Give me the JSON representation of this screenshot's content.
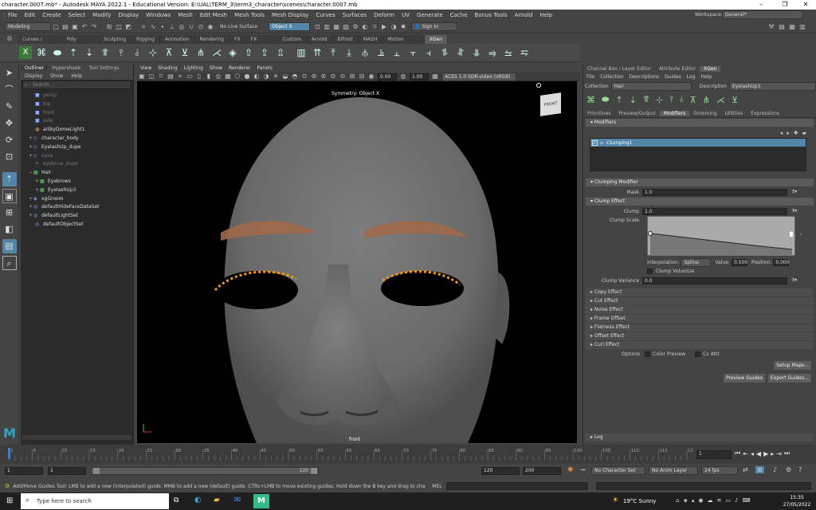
{
  "title_bar": {
    "title": "character.0007.mb* - Autodesk MAYA 2022.1 - Educational Version: E:\\UAL\\TERM_3\\term3_character\\scenes\\character.0007.mb"
  },
  "menu_bar": {
    "items": [
      "File",
      "Edit",
      "Create",
      "Select",
      "Modify",
      "Display",
      "Windows",
      "Mesh",
      "Edit Mesh",
      "Mesh Tools",
      "Mesh Display",
      "Curves",
      "Surfaces",
      "Deform",
      "UV",
      "Generate",
      "Cache",
      "Bonus Tools",
      "Arnold",
      "Help"
    ],
    "workspace_label": "Workspace:",
    "workspace_value": "General*"
  },
  "status_line": {
    "mode": "Modeling",
    "live_surface": "No Live Surface",
    "symmetry": "Object X",
    "sign_in": "Sign In"
  },
  "shelf": {
    "tabs": [
      "Curves / Surfaces",
      "Poly Modeling",
      "Sculpting",
      "Rigging",
      "Animation",
      "Rendering",
      "FX",
      "FX Caching",
      "Custom",
      "Arnold",
      "Bifrost",
      "MASH",
      "Motion Graphics",
      "XGen"
    ],
    "active_tab": "XGen"
  },
  "outliner": {
    "tabs": [
      "Outliner",
      "Hypershade",
      "Tool Settings"
    ],
    "menu": [
      "Display",
      "Show",
      "Help"
    ],
    "search_placeholder": "Search...",
    "items": [
      {
        "label": "persp",
        "dim": true
      },
      {
        "label": "top",
        "dim": true
      },
      {
        "label": "front",
        "dim": true
      },
      {
        "label": "side",
        "dim": true
      },
      {
        "label": "aiSkyDomeLight1",
        "dim": false
      },
      {
        "label": "character_body",
        "dim": false
      },
      {
        "label": "EyelashUp_dupe",
        "dim": false
      },
      {
        "label": "eyes",
        "dim": true
      },
      {
        "label": "eyebrow_dupe",
        "dim": true
      },
      {
        "label": "Hair",
        "dim": false
      },
      {
        "label": "Eyebrows",
        "dim": false
      },
      {
        "label": "EyelashUp3",
        "dim": false
      },
      {
        "label": "xgGroom",
        "dim": false
      },
      {
        "label": "defaultHideFaceDataSet",
        "dim": false
      },
      {
        "label": "defaultLightSet",
        "dim": false
      },
      {
        "label": "defaultObjectSet",
        "dim": false
      }
    ]
  },
  "viewport": {
    "menu": [
      "View",
      "Shading",
      "Lighting",
      "Show",
      "Renderer",
      "Panels"
    ],
    "exposure": "0.00",
    "gamma": "1.00",
    "color_space": "ACES 1.0 SDR-video (sRGB)",
    "symmetry_label": "Symmetry: Object X",
    "camera_label": "front",
    "view_cube_label": "FRONT"
  },
  "right_panel": {
    "tabs": [
      "Channel Box / Layer Editor",
      "Attribute Editor",
      "XGen"
    ],
    "active_tab": "XGen",
    "menu": [
      "File",
      "Collection",
      "Descriptions",
      "Guides",
      "Log",
      "Help"
    ],
    "collection_label": "Collection",
    "collection_value": "Hair",
    "description_label": "Description",
    "description_value": "EyelashUp3",
    "sub_tabs": [
      "Primitives",
      "Preview/Output",
      "Modifiers",
      "Grooming",
      "Utilities",
      "Expressions"
    ],
    "active_sub_tab": "Modifiers",
    "modifiers_header": "Modifiers",
    "modifier_item": "Clumping1",
    "clumping_modifier_header": "Clumping Modifier",
    "mask_label": "Mask",
    "mask_value": "1.0",
    "clump_effect_header": "Clump Effect",
    "clump_label": "Clump",
    "clump_value": "1.0",
    "clump_scale_label": "Clump Scale",
    "interpolation_label": "Interpolation",
    "interpolation_value": "Spline",
    "value_label": "Value",
    "value_value": "0.500",
    "position_label": "Position",
    "position_value": "0.000",
    "clump_volumize": "Clump Volumize",
    "clump_variance_label": "Clump Variance",
    "clump_variance_value": "0.0",
    "collapsed_sections": [
      "Copy Effect",
      "Cut Effect",
      "Noise Effect",
      "Frame Offset",
      "Flatness Effect",
      "Offset Effect",
      "Curl Effect"
    ],
    "options_label": "Options",
    "color_preview": "Color Preview",
    "cv_attr": "Cv Attr",
    "setup_maps": "Setup Maps...",
    "preview_guides": "Preview Guides",
    "export_guides": "Export Guides...",
    "log_header": "Log"
  },
  "time_slider": {
    "ticks": [
      "1",
      "5",
      "10",
      "15",
      "20",
      "25",
      "30",
      "35",
      "40",
      "45",
      "50",
      "55",
      "60",
      "65",
      "70",
      "75",
      "80",
      "85",
      "90",
      "95",
      "100",
      "105",
      "110",
      "115",
      "120"
    ],
    "current_frame": "1"
  },
  "range": {
    "start": "1",
    "playback_start": "1",
    "slider_value": "120",
    "playback_end": "120",
    "end": "200",
    "character_set": "No Character Set",
    "anim_layer": "No Anim Layer",
    "fps": "24 fps"
  },
  "help_line": {
    "text": "Add/Move Guides Tool: LMB to add a new (interpolated) guide. MMB to add a new (default) guide. CTRL+LMB to move existing guides. Hold down the B key and drag to change the tool radius.",
    "mel_label": "MEL"
  },
  "taskbar": {
    "search_placeholder": "Type here to search",
    "weather": "19°C  Sunny",
    "time": "15:35",
    "date": "27/05/2022"
  },
  "colors": {
    "accent": "#5285a6",
    "guide_orange": "#f29a12",
    "timeline_marker": "#3d7dc9"
  }
}
